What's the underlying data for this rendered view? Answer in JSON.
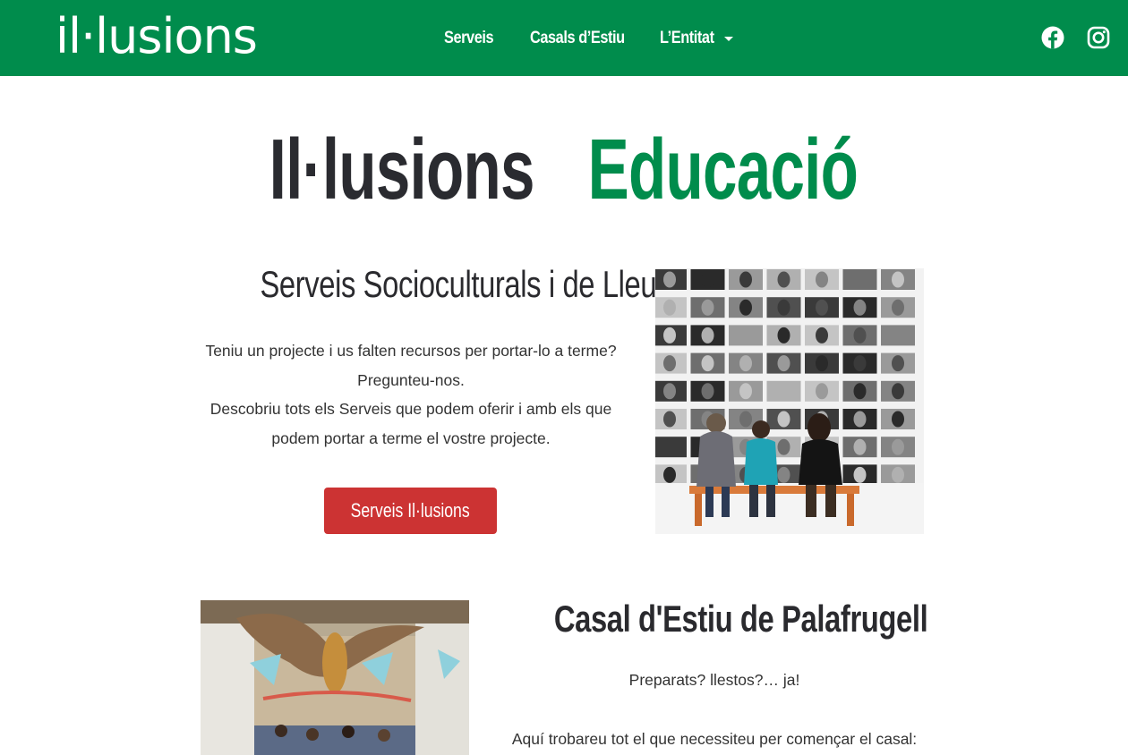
{
  "header": {
    "logo_text": "il·lusions",
    "nav": [
      {
        "label": "Serveis"
      },
      {
        "label": "Casals d’Estiu"
      },
      {
        "label": "L’Entitat"
      }
    ],
    "social": [
      {
        "icon": "facebook-icon"
      },
      {
        "icon": "instagram-icon"
      }
    ],
    "bg_color": "#008c4c"
  },
  "hero": {
    "word1": "Il·lusions",
    "word2": "Educació",
    "accent_color": "#008c4c"
  },
  "section1": {
    "title": "Serveis Socioculturals i de Lleure",
    "lines": [
      "Teniu un projecte i us falten recursos per portar-lo a terme?",
      "Pregunteu-nos.",
      "Descobriu tots els Serveis que podem oferir i amb els que",
      "podem portar a terme el vostre projecte."
    ],
    "button_label": "Serveis Il·lusions",
    "button_color": "#cc3333",
    "image": "photo-wall-people-on-bench"
  },
  "section2": {
    "title": "Casal d'Estiu de Palafrugell",
    "tagline": "Preparats? llestos?… ja!",
    "text": "Aquí trobareu tot el que necessiteu per començar el casal:",
    "image": "summer-camp-hall-photo"
  }
}
